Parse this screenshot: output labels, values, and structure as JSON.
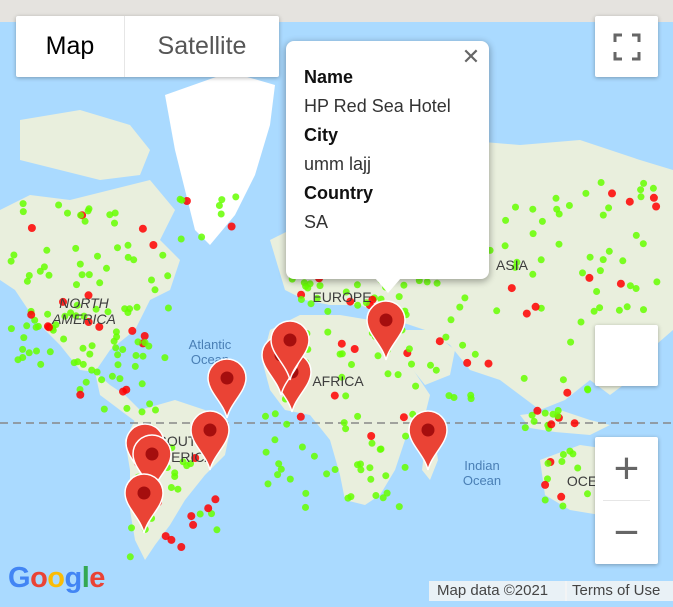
{
  "colors": {
    "ocean": "#aadaff",
    "land": "#e9efdd",
    "ice": "#ffffff",
    "marker": "#ea4335",
    "marker_dot": "#a50e0e",
    "heat_green": "#66ff00",
    "heat_red": "#ff0000",
    "equator": "#888888"
  },
  "map_type": {
    "map_label": "Map",
    "satellite_label": "Satellite",
    "selected": "Map"
  },
  "zoom": {
    "in_label": "+",
    "out_label": "−"
  },
  "labels": {
    "north_america": [
      "NORTH",
      "AMERICA"
    ],
    "south_america": [
      "SOUTH",
      "AMERICA"
    ],
    "europe": "EUROPE",
    "africa": "AFRICA",
    "asia": "ASIA",
    "oceania": "OCE",
    "atlantic": [
      "Atlantic",
      "Ocean"
    ],
    "indian": [
      "Indian",
      "Ocean"
    ]
  },
  "info_window": {
    "name_label": "Name",
    "name_value": "HP Red Sea Hotel",
    "city_label": "City",
    "city_value": "umm lajj",
    "country_label": "Country",
    "country_value": "SA",
    "close_icon": "close-icon"
  },
  "attribution": {
    "map_data": "Map data ©2021",
    "terms": "Terms of Use"
  },
  "logo": {
    "text": "Google"
  }
}
